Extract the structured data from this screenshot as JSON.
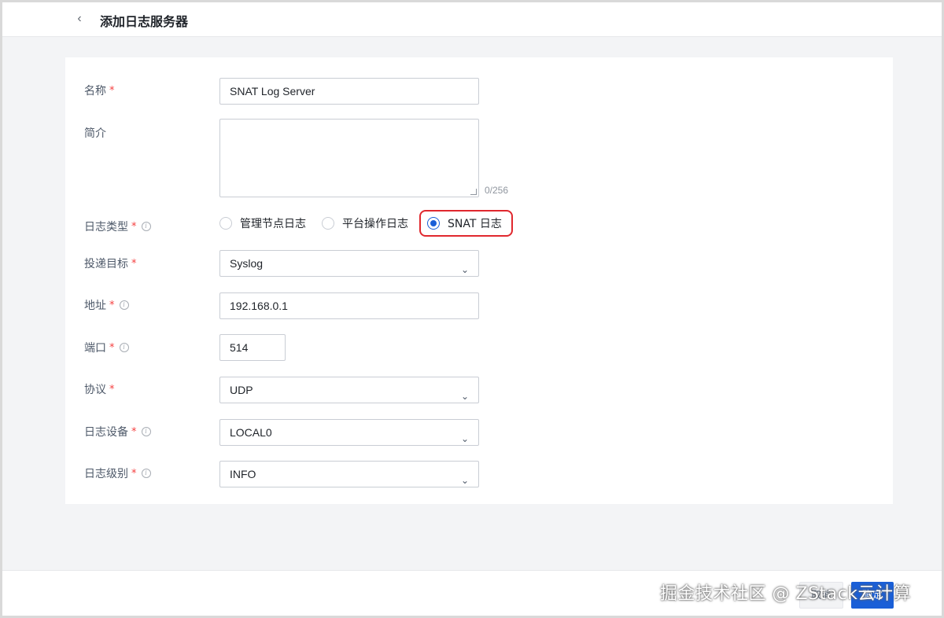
{
  "header": {
    "title": "添加日志服务器",
    "back_icon": "chevron-left-icon"
  },
  "form": {
    "name": {
      "label": "名称",
      "required": "*",
      "value": "SNAT Log Server"
    },
    "description": {
      "label": "简介",
      "value": "",
      "counter": "0/256"
    },
    "log_type": {
      "label": "日志类型",
      "required": "*",
      "options": [
        "管理节点日志",
        "平台操作日志",
        "SNAT 日志"
      ],
      "selected": "SNAT 日志"
    },
    "target": {
      "label": "投递目标",
      "required": "*",
      "value": "Syslog"
    },
    "address": {
      "label": "地址",
      "required": "*",
      "value": "192.168.0.1"
    },
    "port": {
      "label": "端口",
      "required": "*",
      "value": "514"
    },
    "protocol": {
      "label": "协议",
      "required": "*",
      "value": "UDP"
    },
    "facility": {
      "label": "日志设备",
      "required": "*",
      "value": "LOCAL0"
    },
    "level": {
      "label": "日志级别",
      "required": "*",
      "value": "INFO"
    }
  },
  "footer": {
    "cancel_label": "取消",
    "ok_label": "确定"
  },
  "watermark": "掘金技术社区 @ ZStack云计算",
  "colors": {
    "primary": "#1a5fd7",
    "required": "#f53f3f",
    "highlight": "#e0282e"
  }
}
